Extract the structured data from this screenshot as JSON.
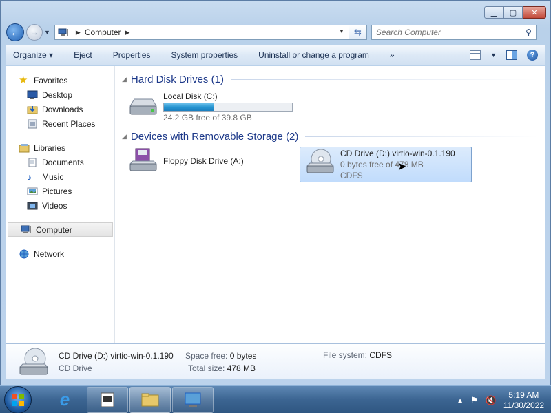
{
  "window": {
    "caption_buttons": {
      "minimize": "▁",
      "maximize": "▢",
      "close": "✕"
    }
  },
  "address": {
    "crumb": "Computer",
    "search_placeholder": "Search Computer"
  },
  "toolbar": {
    "organize": "Organize",
    "eject": "Eject",
    "properties": "Properties",
    "system_properties": "System properties",
    "uninstall": "Uninstall or change a program",
    "more": "»"
  },
  "nav": {
    "favorites": "Favorites",
    "desktop": "Desktop",
    "downloads": "Downloads",
    "recent_places": "Recent Places",
    "libraries": "Libraries",
    "documents": "Documents",
    "music": "Music",
    "pictures": "Pictures",
    "videos": "Videos",
    "computer": "Computer",
    "network": "Network"
  },
  "groups": {
    "hdd_title": "Hard Disk Drives (1)",
    "removable_title": "Devices with Removable Storage (2)"
  },
  "drives": {
    "local": {
      "name": "Local Disk (C:)",
      "free": "24.2 GB free of 39.8 GB",
      "used_fraction": 0.39
    },
    "floppy": {
      "name": "Floppy Disk Drive (A:)"
    },
    "cd": {
      "name": "CD Drive (D:) virtio-win-0.1.190",
      "free": "0 bytes free of 478 MB",
      "fs": "CDFS"
    }
  },
  "details": {
    "name": "CD Drive (D:) virtio-win-0.1.190",
    "type": "CD Drive",
    "space_free_label": "Space free:",
    "space_free": "0 bytes",
    "total_size_label": "Total size:",
    "total_size": "478 MB",
    "fs_label": "File system:",
    "fs": "CDFS"
  },
  "taskbar": {
    "time": "5:19 AM",
    "date": "11/30/2022"
  }
}
